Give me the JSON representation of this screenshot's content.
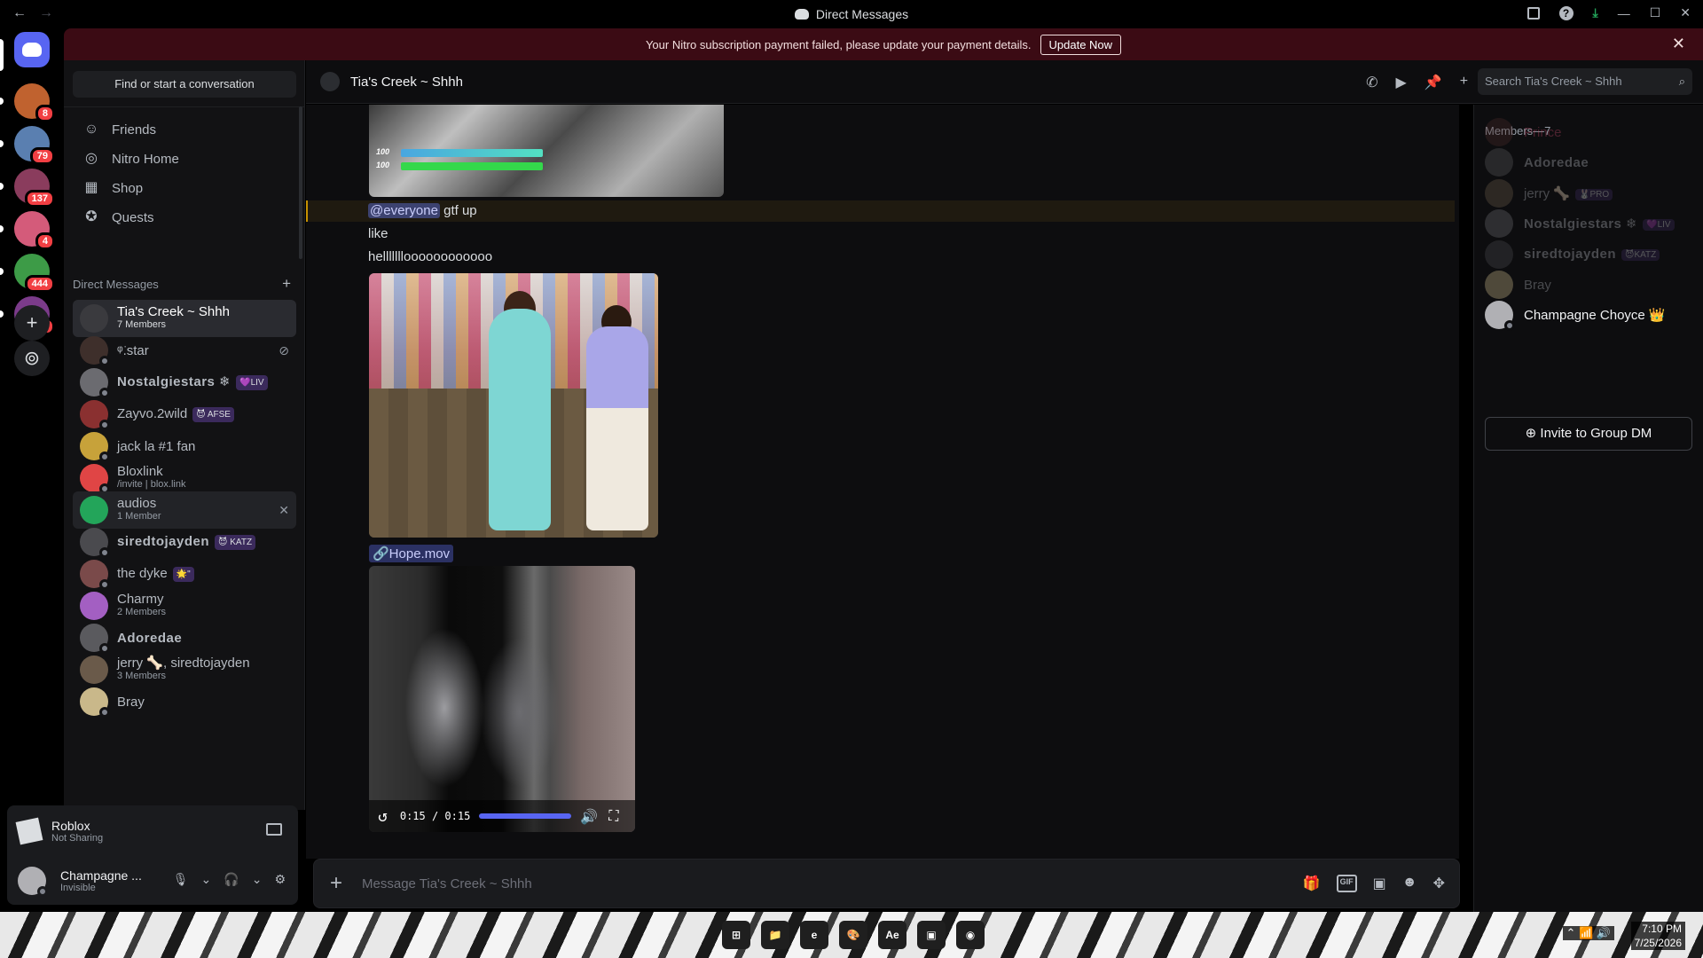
{
  "window": {
    "title": "Direct Messages",
    "back": "←",
    "forward": "→"
  },
  "banner": {
    "text": "Your Nitro subscription payment failed, please update your payment details.",
    "button": "Update Now",
    "close": "✕"
  },
  "servers": [
    {
      "badge": "8",
      "color": "#c0622f"
    },
    {
      "badge": "79",
      "color": "#5a7fb0"
    },
    {
      "badge": "137",
      "color": "#8a3c5d"
    },
    {
      "badge": "4",
      "color": "#d45b7a"
    },
    {
      "badge": "444",
      "color": "#3d9b47"
    },
    {
      "badge": "17",
      "color": "#7b3b8a"
    }
  ],
  "server_actions": {
    "add": "+",
    "discover": "⊚"
  },
  "sidebar": {
    "search": "Find or start a conversation",
    "nav": [
      {
        "label": "Friends",
        "icon": "friends-icon",
        "glyph": "☺"
      },
      {
        "label": "Nitro Home",
        "icon": "nitro-icon",
        "glyph": "◎"
      },
      {
        "label": "Shop",
        "icon": "shop-icon",
        "glyph": "▦"
      },
      {
        "label": "Quests",
        "icon": "quests-icon",
        "glyph": "✪"
      }
    ],
    "dm_header": "Direct Messages",
    "dm_add": "+",
    "dms": [
      {
        "name": "Tia's Creek ~ Shhh",
        "sub": "7 Members",
        "color": "#3a3a3e",
        "selected": true
      },
      {
        "name": "ᵠ͘.star",
        "sub": "",
        "color": "#3e2f2b",
        "blocked_icon": "⊘"
      },
      {
        "name": "Nostalgiestars ❄",
        "sub": "",
        "color": "#6b6b70",
        "tag": "💜LIV",
        "bold": true
      },
      {
        "name": "Zayvo.2wild",
        "sub": "",
        "color": "#8a3030",
        "tag": "😈 AFSE"
      },
      {
        "name": "jack la #1 fan",
        "sub": "",
        "color": "#c7a23a"
      },
      {
        "name": "Bloxlink",
        "sub": "/invite | blox.link",
        "color": "#e04545"
      },
      {
        "name": "audios",
        "sub": "1 Member",
        "color": "#23a55a",
        "hover": true,
        "close_icon": "✕"
      },
      {
        "name": "siredtojayden",
        "sub": "",
        "color": "#4a4a4e",
        "tag": "😈 KATZ",
        "bold": true
      },
      {
        "name": "the dyke",
        "sub": "",
        "color": "#7a4a4a",
        "tag": "🌟\""
      },
      {
        "name": "Charmy",
        "sub": "2 Members",
        "color": "#a35fc2"
      },
      {
        "name": "Adoredae",
        "sub": "",
        "color": "#5a5a5e",
        "bold": true
      },
      {
        "name": "jerry 🦴, siredtojayden",
        "sub": "3 Members",
        "color": "#6a5a4a"
      },
      {
        "name": "Bray",
        "sub": "",
        "color": "#c9b88a"
      }
    ]
  },
  "activity": {
    "name": "Roblox",
    "status": "Not Sharing"
  },
  "user": {
    "name": "Champagne ...",
    "status": "Invisible",
    "mic": "🎙",
    "headset": "🎧",
    "chevron": "⌄",
    "settings": "⚙"
  },
  "chat": {
    "title": "Tia's Creek ~ Shhh",
    "search_placeholder": "Search Tia's Creek ~ Shhh",
    "header_icons": {
      "call": "✆",
      "video": "▶",
      "pin": "📌",
      "add_member": "+",
      "members": "👥",
      "search": "⌕"
    },
    "game_hud": {
      "top": "100",
      "bottom": "100"
    },
    "messages": [
      {
        "mention": "@everyone",
        "text": " gtf up"
      },
      {
        "text": "like"
      },
      {
        "text": "hellllllloooooooooooo"
      }
    ],
    "attachment": "🔗Hope.mov",
    "video": {
      "time": "0:15 / 0:15",
      "progress": 1.0,
      "replay": "↺",
      "volume": "🔊",
      "fullscreen": "⛶"
    },
    "composer_placeholder": "Message Tia's Creek ~ Shhh",
    "composer_plus": "+",
    "composer_tools": {
      "gift": "🎁",
      "gif": "GIF",
      "sticker": "▣",
      "emoji": "☻",
      "apps": "✥"
    }
  },
  "members": {
    "header": "Members—7",
    "list": [
      {
        "name": "Prince",
        "color": "#4a2a2a",
        "name_color": "#c24a6a",
        "faded": true
      },
      {
        "name": "Adoredae",
        "color": "#5a5a5e",
        "name_color": "#b5bac1",
        "faded": true,
        "bold": true
      },
      {
        "name": "jerry 🦴",
        "color": "#6a5a4a",
        "name_color": "#b5bac1",
        "faded": true,
        "tag": "🐰PRO"
      },
      {
        "name": "Nostalgiestars ❄",
        "color": "#6b6b70",
        "name_color": "#b5bac1",
        "faded": true,
        "tag": "💜LIV",
        "bold": true
      },
      {
        "name": "siredtojayden",
        "color": "#4a4a4e",
        "name_color": "#b5bac1",
        "faded": true,
        "tag": "😈KATZ",
        "bold": true
      },
      {
        "name": "Bray",
        "color": "#c9b88a",
        "name_color": "#b5bac1",
        "faded": true
      },
      {
        "name": "Champagne Choyce 👑",
        "color": "#b0b0b4",
        "name_color": "#f2f3f5",
        "faded": false
      }
    ],
    "invite": "Invite to Group DM"
  },
  "taskbar": {
    "apps": [
      "⊞",
      "📁",
      "e",
      "🎨",
      "Ae",
      "▣",
      "◉"
    ],
    "tray": "⌃  📶  🔊",
    "time": "7:10 PM",
    "date": "7/25/2026"
  }
}
